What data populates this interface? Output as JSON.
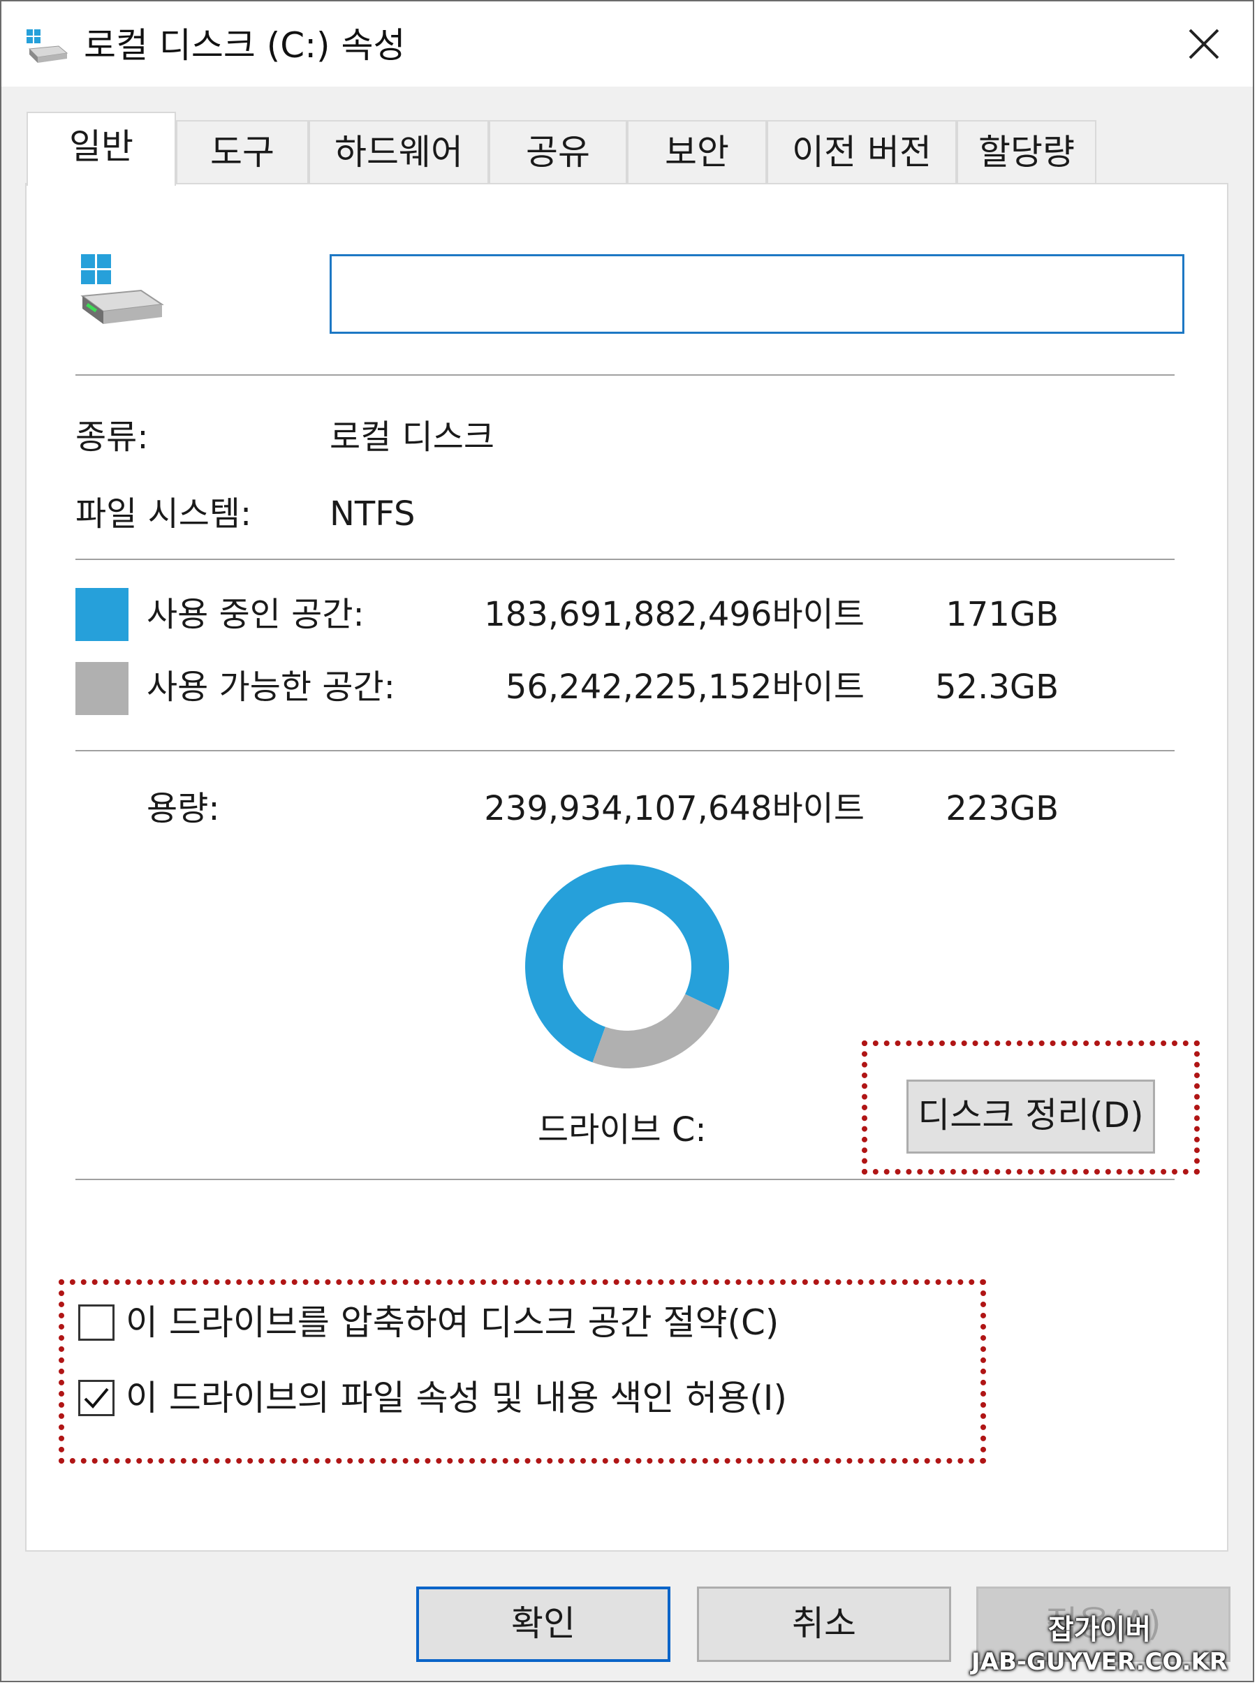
{
  "window": {
    "title": "로컬 디스크 (C:) 속성"
  },
  "tabs": [
    {
      "label": "일반",
      "active": true
    },
    {
      "label": "도구",
      "active": false
    },
    {
      "label": "하드웨어",
      "active": false
    },
    {
      "label": "공유",
      "active": false
    },
    {
      "label": "보안",
      "active": false
    },
    {
      "label": "이전 버전",
      "active": false
    },
    {
      "label": "할당량",
      "active": false
    }
  ],
  "general": {
    "drive_name_value": "",
    "type_label": "종류:",
    "type_value": "로컬 디스크",
    "fs_label": "파일 시스템:",
    "fs_value": "NTFS",
    "used_label": "사용 중인 공간:",
    "used_bytes": "183,691,882,496바이트",
    "used_size": "171GB",
    "free_label": "사용 가능한 공간:",
    "free_bytes": "56,242,225,152바이트",
    "free_size": "52.3GB",
    "capacity_label": "용량:",
    "capacity_bytes": "239,934,107,648바이트",
    "capacity_size": "223GB",
    "drive_caption": "드라이브 C:",
    "cleanup_button": "디스크 정리(D)",
    "compress_label": "이 드라이브를 압축하여 디스크 공간 절약(C)",
    "compress_checked": false,
    "index_label": "이 드라이브의 파일 속성 및 내용 색인 허용(I)",
    "index_checked": true
  },
  "chart_data": {
    "type": "pie",
    "categories": [
      "사용 중인 공간",
      "사용 가능한 공간"
    ],
    "values": [
      171,
      52.3
    ],
    "colors": [
      "#26a0da",
      "#b0b0b0"
    ]
  },
  "buttons": {
    "ok": "확인",
    "cancel": "취소",
    "apply": "적용(A)"
  },
  "colors": {
    "used": "#26a0da",
    "free": "#b0b0b0",
    "focus": "#0a64c8",
    "highlight": "#b01515"
  },
  "watermark": {
    "line1": "잡가이버",
    "line2": "JAB-GUYVER.CO.KR"
  }
}
